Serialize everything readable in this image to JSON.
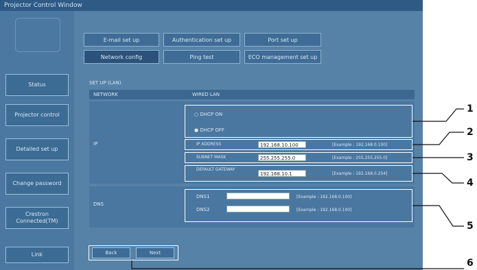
{
  "window": {
    "title": "Projector Control Window"
  },
  "sidebar": {
    "items": [
      {
        "label": "Status"
      },
      {
        "label": "Projector control"
      },
      {
        "label": "Detailed set up"
      },
      {
        "label": "Change password"
      },
      {
        "label": "Crestron Connected(TM)"
      },
      {
        "label": "Link"
      }
    ]
  },
  "tabs": {
    "row1": [
      "E-mail set up",
      "Authentication set up",
      "Port set up"
    ],
    "row2": [
      "Network config",
      "Ping test",
      "ECO management set up"
    ]
  },
  "section": {
    "title": "SET UP (LAN)",
    "col1": "NETWORK",
    "col2": "WIRED LAN"
  },
  "ip": {
    "label": "IP",
    "dhcp_on": "DHCP ON",
    "dhcp_off": "DHCP OFF",
    "ip_label": "IP ADDRESS",
    "ip_value": "192.168.10.100",
    "ip_example": "[Example : 192.168.0.100]",
    "mask_label": "SUBNET MASK",
    "mask_value": "255.255.255.0",
    "mask_example": "[Example : 255.255.255.0]",
    "gw_label": "DEFAULT GATEWAY",
    "gw_value": "192.168.10.1",
    "gw_example": "[Example : 192.168.0.254]"
  },
  "dns": {
    "label": "DNS",
    "dns1_label": "DNS1",
    "dns1_value": "",
    "dns1_example": "[Example : 192.168.0.100]",
    "dns2_label": "DNS2",
    "dns2_value": "",
    "dns2_example": "[Example : 192.168.0.100]"
  },
  "buttons": {
    "back": "Back",
    "next": "Next"
  },
  "callouts": [
    "1",
    "2",
    "3",
    "4",
    "5",
    "6"
  ]
}
